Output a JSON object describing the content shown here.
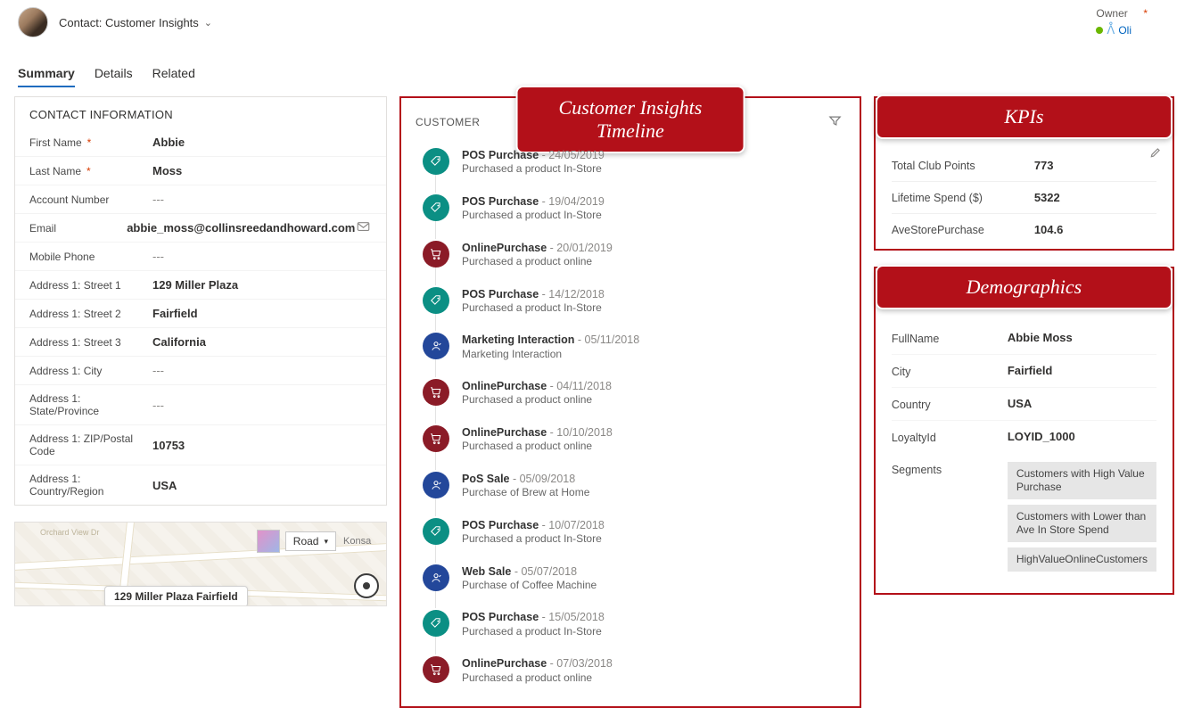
{
  "header": {
    "form_title": "Contact: Customer Insights",
    "owner_label": "Owner",
    "owner_name": "Oli"
  },
  "tabs": [
    {
      "label": "Summary",
      "active": true
    },
    {
      "label": "Details",
      "active": false
    },
    {
      "label": "Related",
      "active": false
    }
  ],
  "contact_info": {
    "title": "CONTACT INFORMATION",
    "rows": [
      {
        "label": "First Name",
        "value": "Abbie",
        "required": true
      },
      {
        "label": "Last Name",
        "value": "Moss",
        "required": true
      },
      {
        "label": "Account Number",
        "value": "---"
      },
      {
        "label": "Email",
        "value": "abbie_moss@collinsreedandhoward.com",
        "action": "mail"
      },
      {
        "label": "Mobile Phone",
        "value": "---"
      },
      {
        "label": "Address 1: Street 1",
        "value": "129 Miller Plaza"
      },
      {
        "label": "Address 1: Street 2",
        "value": "Fairfield"
      },
      {
        "label": "Address 1: Street 3",
        "value": "California"
      },
      {
        "label": "Address 1: City",
        "value": "---"
      },
      {
        "label": "Address 1: State/Province",
        "value": "---"
      },
      {
        "label": "Address 1: ZIP/Postal Code",
        "value": "10753"
      },
      {
        "label": "Address 1: Country/Region",
        "value": "USA"
      }
    ]
  },
  "map": {
    "view_label": "Road",
    "search_placeholder": "Konsa",
    "tooltip": "129 Miller Plaza Fairfield",
    "street1": "Orchard View Dr"
  },
  "timeline": {
    "panel_label": "CUSTOMER",
    "callout": "Customer Insights Timeline",
    "items": [
      {
        "icon": "teal-tag",
        "title": "POS Purchase",
        "date": "24/05/2019",
        "desc": "Purchased a product In-Store"
      },
      {
        "icon": "teal-tag",
        "title": "POS Purchase",
        "date": "19/04/2019",
        "desc": "Purchased a product In-Store"
      },
      {
        "icon": "maroon-cart",
        "title": "OnlinePurchase",
        "date": "20/01/2019",
        "desc": "Purchased a product online"
      },
      {
        "icon": "teal-tag",
        "title": "POS Purchase",
        "date": "14/12/2018",
        "desc": "Purchased a product In-Store"
      },
      {
        "icon": "navy-person",
        "title": "Marketing Interaction",
        "date": "05/11/2018",
        "desc": "Marketing Interaction"
      },
      {
        "icon": "maroon-cart",
        "title": "OnlinePurchase",
        "date": "04/11/2018",
        "desc": "Purchased a product online"
      },
      {
        "icon": "maroon-cart",
        "title": "OnlinePurchase",
        "date": "10/10/2018",
        "desc": "Purchased a product online"
      },
      {
        "icon": "navy-person",
        "title": "PoS Sale",
        "date": "05/09/2018",
        "desc": "Purchase of Brew at Home"
      },
      {
        "icon": "teal-tag",
        "title": "POS Purchase",
        "date": "10/07/2018",
        "desc": "Purchased a product In-Store"
      },
      {
        "icon": "navy-person",
        "title": "Web Sale",
        "date": "05/07/2018",
        "desc": "Purchase of Coffee Machine"
      },
      {
        "icon": "teal-tag",
        "title": "POS Purchase",
        "date": "15/05/2018",
        "desc": "Purchased a product In-Store"
      },
      {
        "icon": "maroon-cart",
        "title": "OnlinePurchase",
        "date": "07/03/2018",
        "desc": "Purchased a product online"
      }
    ]
  },
  "kpis": {
    "callout": "KPIs",
    "rows": [
      {
        "label": "Total Club Points",
        "value": "773"
      },
      {
        "label": "Lifetime Spend ($)",
        "value": "5322"
      },
      {
        "label": "AveStorePurchase",
        "value": "104.6"
      }
    ]
  },
  "demographics": {
    "callout": "Demographics",
    "rows": [
      {
        "label": "FullName",
        "value": "Abbie Moss"
      },
      {
        "label": "City",
        "value": "Fairfield"
      },
      {
        "label": "Country",
        "value": "USA"
      },
      {
        "label": "LoyaltyId",
        "value": "LOYID_1000"
      }
    ],
    "segments_label": "Segments",
    "segments": [
      "Customers with High Value Purchase",
      "Customers with Lower than Ave In Store Spend",
      "HighValueOnlineCustomers"
    ]
  }
}
